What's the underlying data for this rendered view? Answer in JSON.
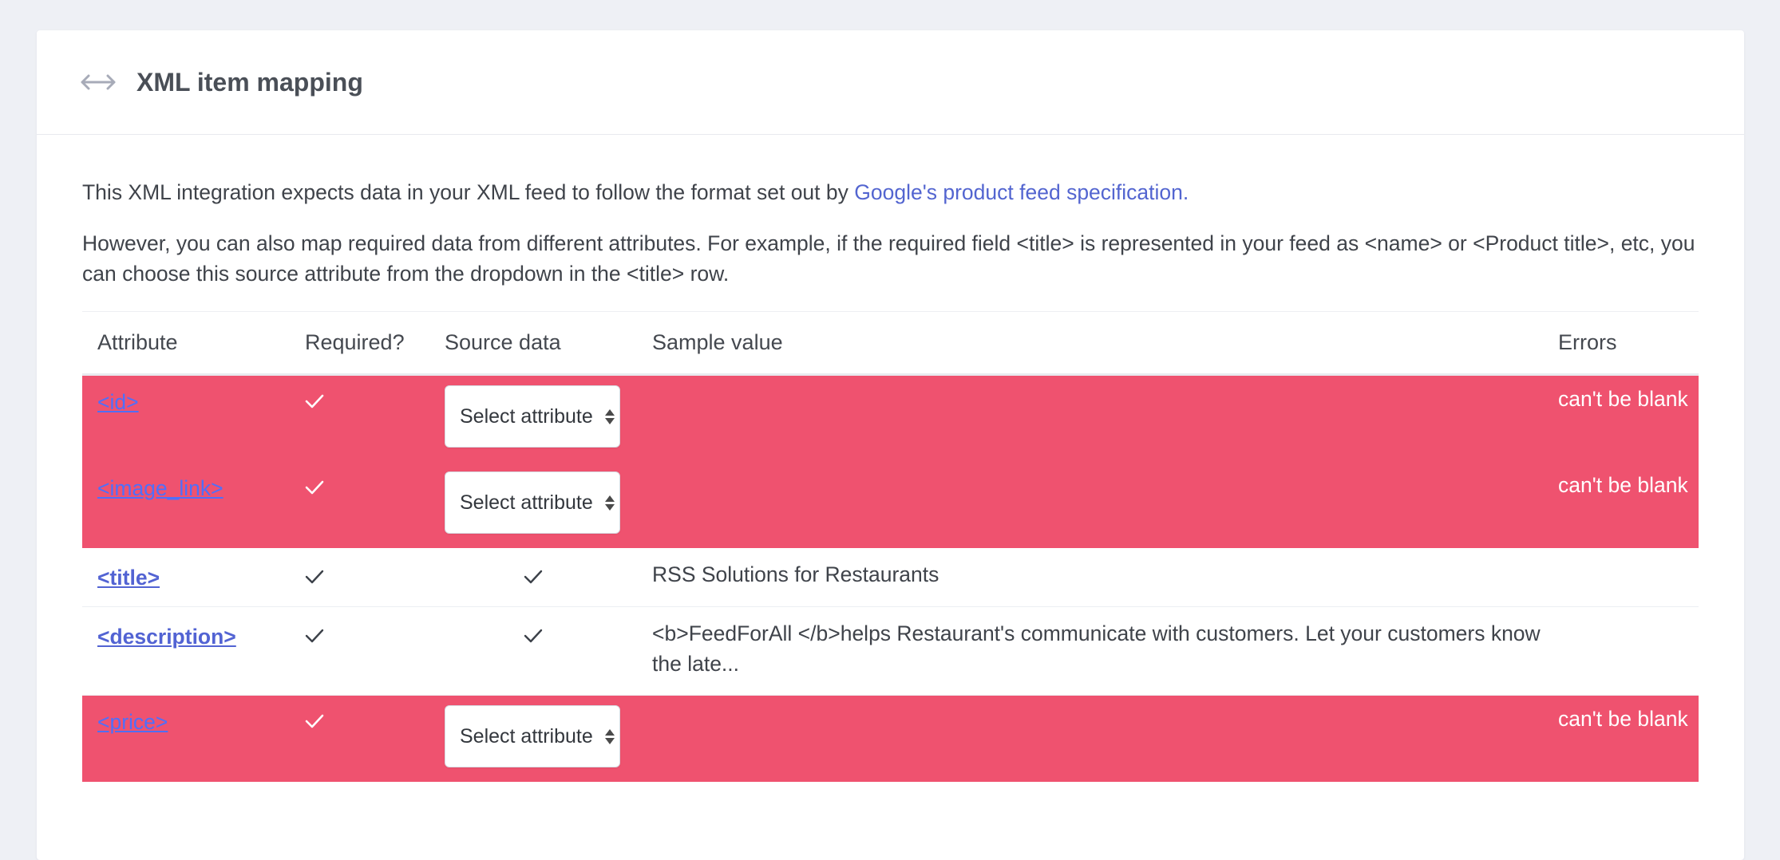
{
  "header": {
    "title": "XML item mapping",
    "icon": "arrows-horizontal-icon"
  },
  "intro": {
    "line1_text": "This XML integration expects data in your XML feed to follow the format set out by ",
    "line1_link": "Google's product feed specification.",
    "line2": "However, you can also map required data from different attributes. For example, if the required field <title> is represented in your feed as <name> or <Product title>, etc, you can choose this source attribute from the dropdown in the <title> row."
  },
  "table": {
    "headers": {
      "attribute": "Attribute",
      "required": "Required?",
      "source": "Source data",
      "sample": "Sample value",
      "errors": "Errors"
    },
    "rows": [
      {
        "attribute": "<id>",
        "required": true,
        "source": "Select attribute",
        "sample": "",
        "error": "can't be blank"
      },
      {
        "attribute": "<image_link>",
        "required": true,
        "source": "Select attribute",
        "sample": "",
        "error": "can't be blank"
      },
      {
        "attribute": "<title>",
        "required": true,
        "source_ok": true,
        "sample": "RSS Solutions for Restaurants",
        "error": ""
      },
      {
        "attribute": "<description>",
        "required": true,
        "source_ok": true,
        "sample": "<b>FeedForAll </b>helps Restaurant's communicate with customers. Let your customers know the late...",
        "error": ""
      },
      {
        "attribute": "<price>",
        "required": true,
        "source": "Select attribute",
        "sample": "",
        "error": "can't be blank"
      }
    ]
  },
  "colors": {
    "error_row": "#ef526f",
    "link": "#5365d0",
    "background": "#eef0f5"
  }
}
